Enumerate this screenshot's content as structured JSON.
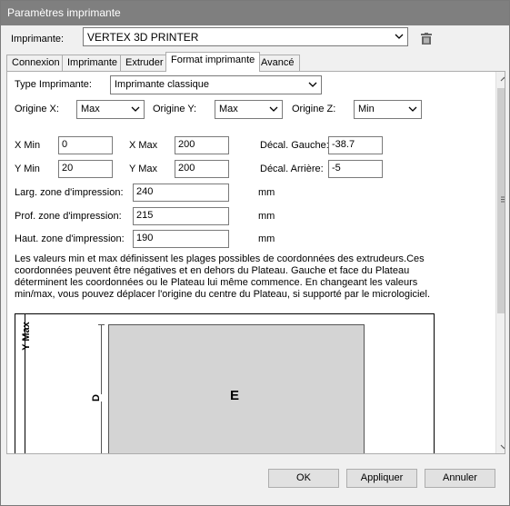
{
  "window": {
    "title": "Paramètres imprimante"
  },
  "printer": {
    "label": "Imprimante:",
    "value": "VERTEX 3D PRINTER"
  },
  "tabs": [
    "Connexion",
    "Imprimante",
    "Extruder",
    "Format imprimante",
    "Avancé"
  ],
  "form": {
    "type_label": "Type Imprimante:",
    "type_value": "Imprimante classique",
    "origin_x_label": "Origine X:",
    "origin_x_value": "Max",
    "origin_y_label": "Origine Y:",
    "origin_y_value": "Max",
    "origin_z_label": "Origine Z:",
    "origin_z_value": "Min",
    "xmin_label": "X Min",
    "xmin_value": "0",
    "xmax_label": "X Max",
    "xmax_value": "200",
    "decal_gauche_label": "Décal. Gauche:",
    "decal_gauche_value": "-38.7",
    "ymin_label": "Y Min",
    "ymin_value": "20",
    "ymax_label": "Y Max",
    "ymax_value": "200",
    "decal_arriere_label": "Décal. Arrière:",
    "decal_arriere_value": "-5",
    "larg_label": "Larg. zone d'impression:",
    "larg_value": "240",
    "prof_label": "Prof. zone d'impression:",
    "prof_value": "215",
    "haut_label": "Haut. zone d'impression:",
    "haut_value": "190",
    "unit": "mm",
    "description": "Les valeurs min et max définissent les plages possibles de coordonnées des extrudeurs.Ces coordonnées peuvent être négatives et en dehors du Plateau. Gauche et face du Plateau déterminent les coordonnées ou le Plateau lui même commence. En changeant les valeurs min/max, vous pouvez déplacer l'origine du centre du Plateau, si supporté par le micrologiciel."
  },
  "diagram": {
    "ymax_label": "Y Max",
    "d_label": "D",
    "e_label": "E"
  },
  "buttons": {
    "ok": "OK",
    "apply": "Appliquer",
    "cancel": "Annuler"
  },
  "icons": {
    "delete": "trash-icon",
    "dropdown": "chevron-down-icon"
  }
}
